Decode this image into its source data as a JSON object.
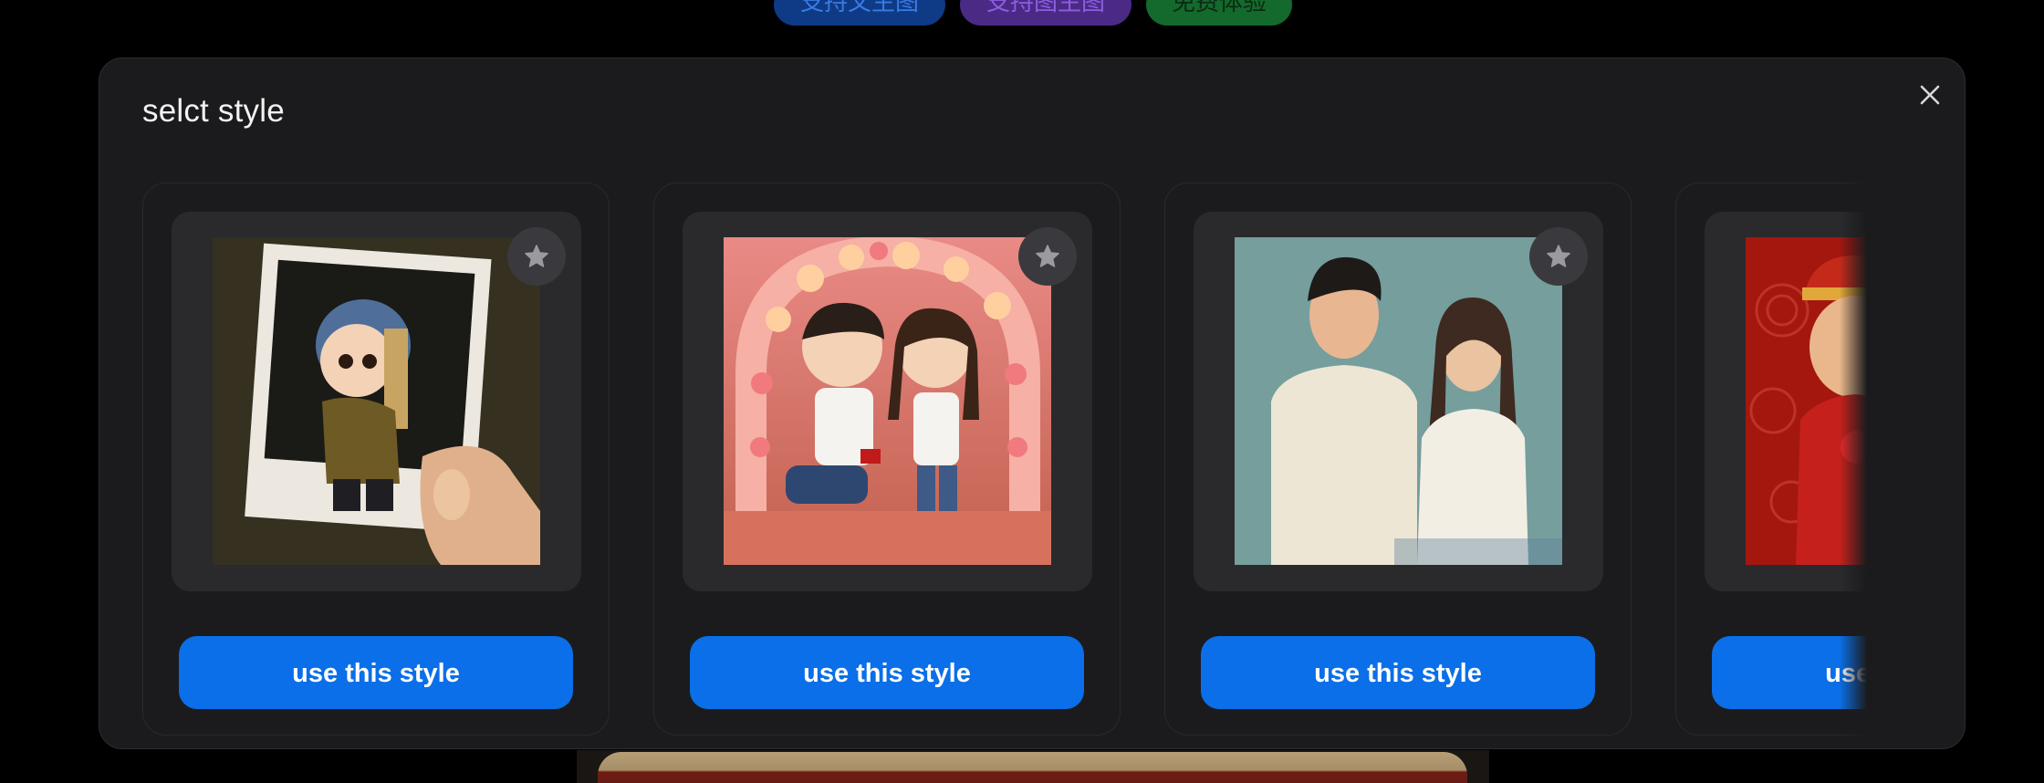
{
  "background": {
    "pills": [
      {
        "label": "支持文生图",
        "color": "#0e3a86"
      },
      {
        "label": "支持图生图",
        "color": "#4b2a86"
      },
      {
        "label": "免费体验",
        "color": "#14692d"
      }
    ]
  },
  "modal": {
    "title": "selct style",
    "close_icon": "close-icon",
    "cards": [
      {
        "thumbnail": "girl-with-pearl-earring-chibi-polaroid",
        "favorite_icon": "star-icon",
        "button_label": "use this style"
      },
      {
        "thumbnail": "chibi-couple-proposal-flower-arch",
        "favorite_icon": "star-icon",
        "button_label": "use this style"
      },
      {
        "thumbnail": "illustrated-couple-portrait",
        "favorite_icon": "star-icon",
        "button_label": "use this style"
      },
      {
        "thumbnail": "chibi-groom-red-traditional-outfit",
        "favorite_icon": "star-icon",
        "button_label": "use this style"
      }
    ]
  },
  "colors": {
    "accent": "#0a6fe8",
    "modal_bg": "#1b1b1d",
    "card_frame": "#2a2a2d"
  }
}
